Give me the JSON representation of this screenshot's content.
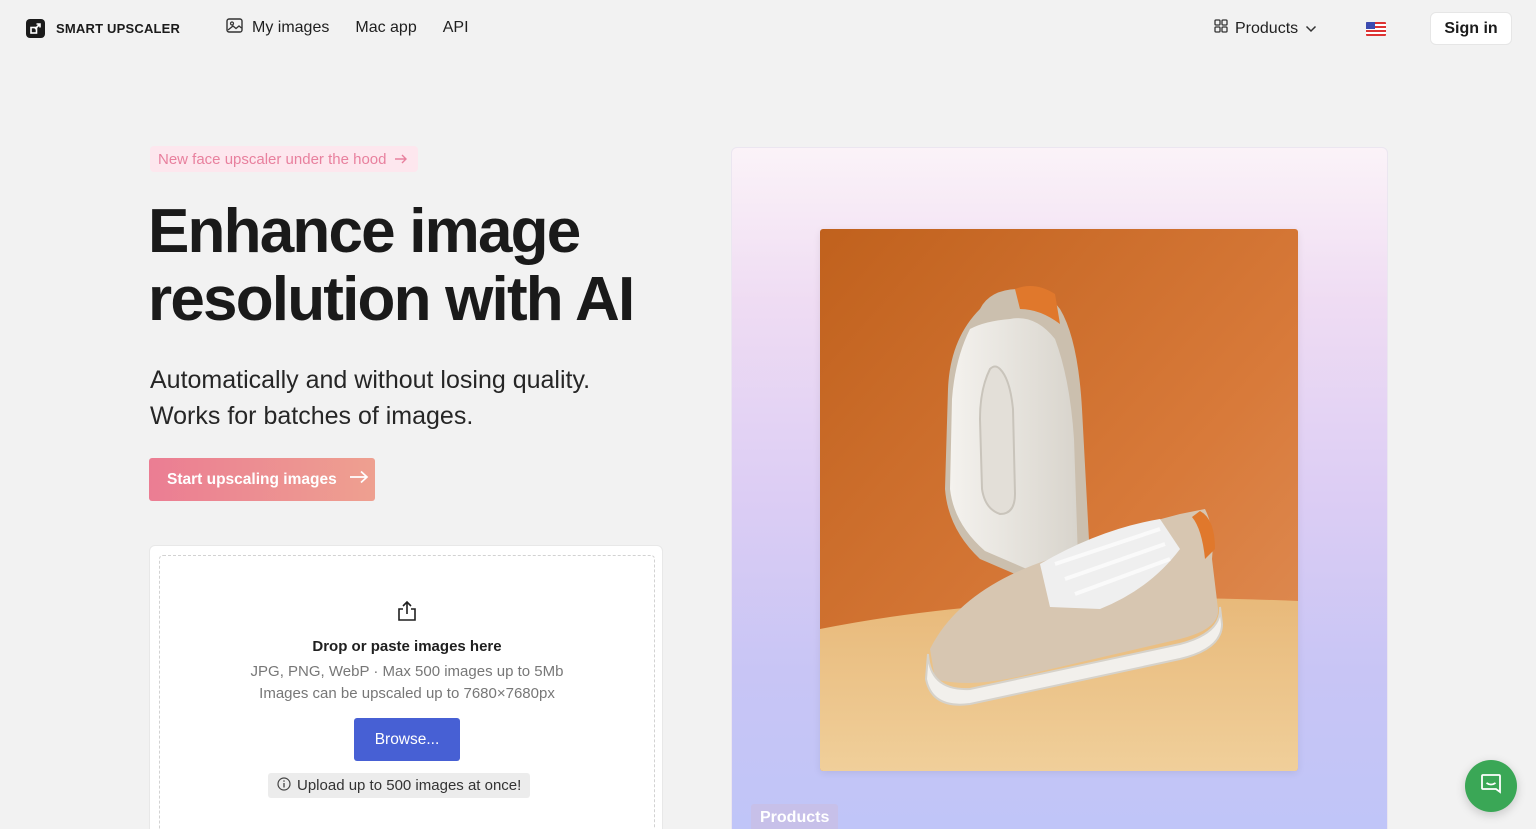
{
  "header": {
    "logo_text": "SMART UPSCALER",
    "nav": [
      {
        "label": "My images",
        "icon": "images-icon"
      },
      {
        "label": "Mac app"
      },
      {
        "label": "API"
      }
    ],
    "products_label": "Products",
    "signin_label": "Sign in"
  },
  "hero": {
    "badge_text": "New face upscaler under the hood",
    "title_line1": "Enhance image",
    "title_line2": "resolution with AI",
    "subtitle_line1": "Automatically and without losing quality.",
    "subtitle_line2": "Works for batches of images.",
    "cta_label": "Start upscaling images"
  },
  "upload": {
    "title": "Drop or paste images here",
    "formats": "JPG, PNG, WebP · Max 500 images up to 5Mb",
    "limit": "Images can be upscaled up to 7680×7680px",
    "browse_label": "Browse...",
    "note": "Upload up to 500 images at once!"
  },
  "showcase": {
    "label": "Products"
  },
  "colors": {
    "accent_blue": "#4760d4",
    "cta_pink": "#eb7d93",
    "badge_pink": "#e8809e",
    "chat_green": "#3aa756"
  }
}
